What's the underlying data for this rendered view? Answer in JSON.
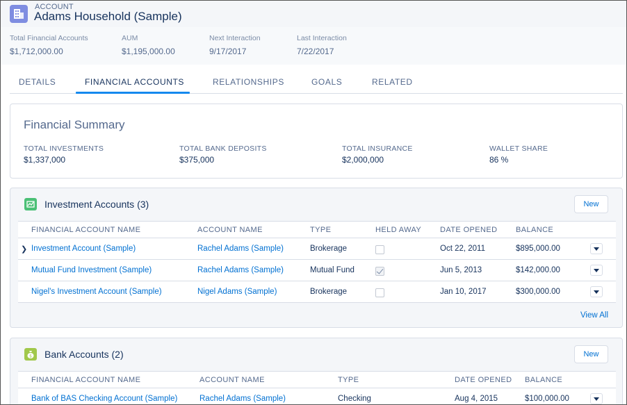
{
  "record": {
    "object_label": "ACCOUNT",
    "title": "Adams Household (Sample)",
    "highlights": [
      {
        "label": "Total Financial Accounts",
        "value": "$1,712,000.00"
      },
      {
        "label": "AUM",
        "value": "$1,195,000.00"
      },
      {
        "label": "Next Interaction",
        "value": "9/17/2017"
      },
      {
        "label": "Last Interaction",
        "value": "7/22/2017"
      }
    ]
  },
  "tabs": [
    {
      "label": "DETAILS"
    },
    {
      "label": "FINANCIAL ACCOUNTS",
      "active": true
    },
    {
      "label": "RELATIONSHIPS"
    },
    {
      "label": "GOALS"
    },
    {
      "label": "RELATED"
    }
  ],
  "summary": {
    "title": "Financial Summary",
    "items": [
      {
        "label": "TOTAL INVESTMENTS",
        "value": "$1,337,000"
      },
      {
        "label": "TOTAL BANK DEPOSITS",
        "value": "$375,000"
      },
      {
        "label": "TOTAL INSURANCE",
        "value": "$2,000,000"
      },
      {
        "label": "WALLET SHARE",
        "value": "86 %"
      }
    ]
  },
  "investment": {
    "title": "Investment Accounts (3)",
    "new_label": "New",
    "icon_color": "#4bc076",
    "columns": [
      "FINANCIAL ACCOUNT NAME",
      "ACCOUNT NAME",
      "TYPE",
      "HELD AWAY",
      "DATE OPENED",
      "BALANCE"
    ],
    "rows": [
      {
        "name": "Investment Account (Sample)",
        "account": "Rachel Adams (Sample)",
        "type": "Brokerage",
        "held_away": false,
        "opened": "Oct 22, 2011",
        "balance": "$895,000.00"
      },
      {
        "name": "Mutual Fund Investment (Sample)",
        "account": "Rachel Adams (Sample)",
        "type": "Mutual Fund",
        "held_away": true,
        "opened": "Jun 5, 2013",
        "balance": "$142,000.00"
      },
      {
        "name": "Nigel's Investment Account (Sample)",
        "account": "Nigel Adams (Sample)",
        "type": "Brokerage",
        "held_away": false,
        "opened": "Jan 10, 2017",
        "balance": "$300,000.00"
      }
    ],
    "view_all": "View All"
  },
  "bank": {
    "title": "Bank Accounts (2)",
    "new_label": "New",
    "icon_color": "#a1c84b",
    "columns": [
      "FINANCIAL ACCOUNT NAME",
      "ACCOUNT NAME",
      "TYPE",
      "DATE OPENED",
      "BALANCE"
    ],
    "rows": [
      {
        "name": "Bank of BAS Checking Account (Sample)",
        "account": "Rachel Adams (Sample)",
        "type": "Checking",
        "opened": "Aug 4, 2015",
        "balance": "$100,000.00"
      }
    ]
  },
  "icons": {
    "account": "building-icon",
    "investment": "chart-icon",
    "bank": "money-bag-icon",
    "row_expand": "chevron-right-icon",
    "row_menu": "chevron-down-icon"
  }
}
